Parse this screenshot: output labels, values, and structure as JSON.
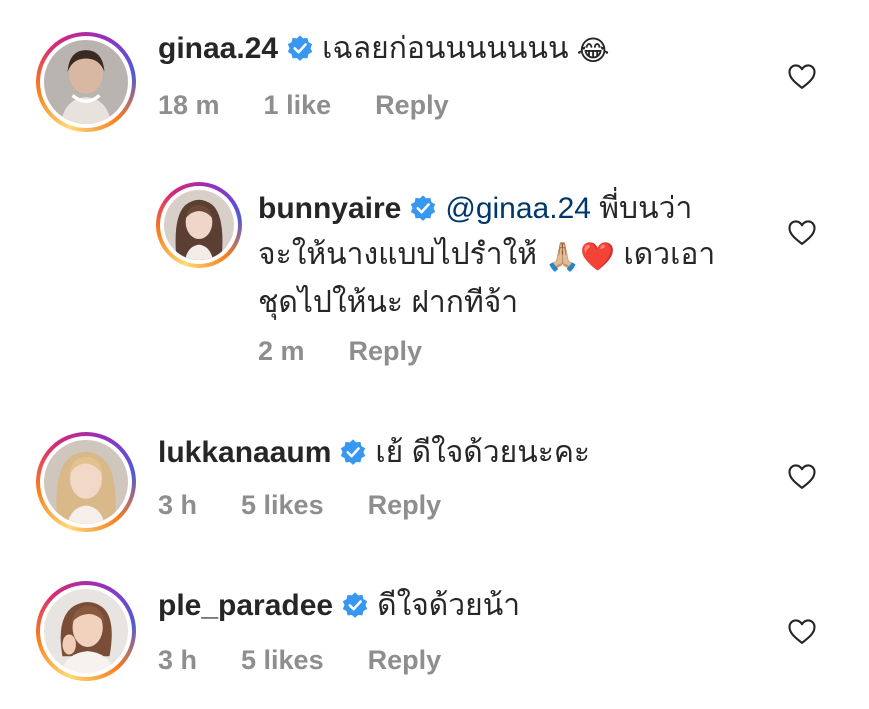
{
  "comments": [
    {
      "username": "ginaa.24",
      "text": "เฉลยก่อนนนนนนน",
      "emoji": "😂",
      "time": "18 m",
      "likes": "1 like",
      "reply_label": "Reply"
    },
    {
      "username": "bunnyaire",
      "mention": "@ginaa.24",
      "line1": "พี่บนว่า",
      "line2a": "จะให้นางแบบไปรำให้",
      "emoji1": "🙏🏼",
      "emoji2": "❤️",
      "line2b": "เดวเอา",
      "line3": "ชุดไปให้นะ ฝากทีจ้า",
      "time": "2 m",
      "reply_label": "Reply"
    },
    {
      "username": "lukkanaaum",
      "text": "เย้ ดีใจด้วยนะคะ",
      "time": "3 h",
      "likes": "5 likes",
      "reply_label": "Reply"
    },
    {
      "username": "ple_paradee",
      "text": "ดีใจด้วยน้า",
      "time": "3 h",
      "likes": "5 likes",
      "reply_label": "Reply"
    }
  ],
  "colors": {
    "text": "#262626",
    "meta": "#8e8e8e",
    "mention": "#00376b",
    "verified": "#3897f0"
  },
  "icons": {
    "verified": "verified-badge-icon",
    "like": "heart-outline-icon"
  }
}
